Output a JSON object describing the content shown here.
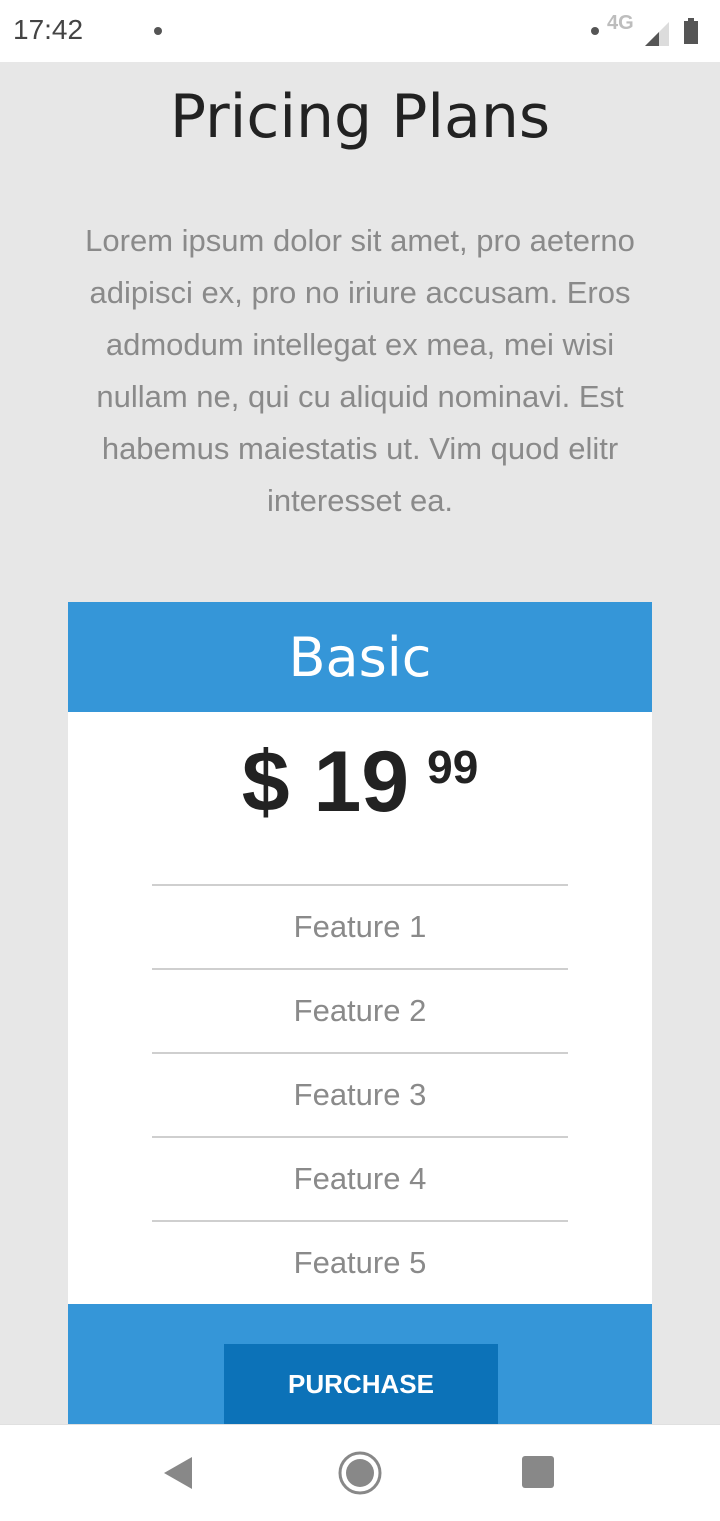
{
  "status_bar": {
    "time": "17:42",
    "network": "4G",
    "icons": [
      "notification-dot-icon",
      "signal-icon",
      "battery-icon"
    ]
  },
  "page": {
    "title": "Pricing Plans",
    "intro": "Lorem ipsum dolor sit amet, pro aeterno adipisci ex, pro no iriure accusam. Eros admodum intellegat ex mea, mei wisi nullam ne, qui cu aliquid nominavi. Est habemus maiestatis ut. Vim quod elitr interesset ea."
  },
  "plan": {
    "name": "Basic",
    "price_main": "$ 19",
    "price_cents": "99",
    "features": [
      "Feature 1",
      "Feature 2",
      "Feature 3",
      "Feature 4",
      "Feature 5"
    ],
    "purchase_label": "PURCHASE"
  },
  "nav_bar": {
    "icons": [
      "back-icon",
      "home-icon",
      "recents-icon"
    ]
  },
  "colors": {
    "accent": "#3596d8",
    "button": "#0c72b8",
    "background": "#e7e7e7"
  }
}
